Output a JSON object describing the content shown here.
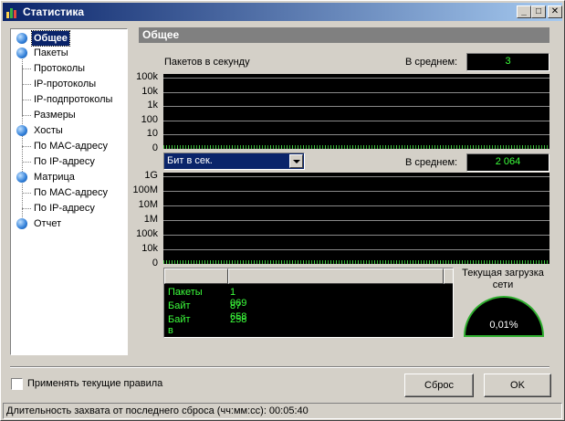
{
  "window": {
    "title": "Статистика",
    "minimize": "_",
    "maximize": "□",
    "close": "✕"
  },
  "tree": {
    "general": "Общее",
    "packets": "Пакеты",
    "protocols": "Протоколы",
    "ip_protocols": "IP-протоколы",
    "ip_subprotocols": "IP-подпротоколы",
    "sizes": "Размеры",
    "hosts": "Хосты",
    "hosts_mac": "По MAC-адресу",
    "hosts_ip": "По IP-адресу",
    "matrix": "Матрица",
    "matrix_mac": "По MAC-адресу",
    "matrix_ip": "По IP-адресу",
    "report": "Отчет"
  },
  "panel": {
    "header": "Общее",
    "pps_label": "Пакетов в секунду",
    "avg_label": "В среднем:",
    "pps_avg": "3",
    "pps_ticks": [
      "100k",
      "10k",
      "1k",
      "100",
      "10",
      "0"
    ],
    "bps_combo": "Бит в сек.",
    "bps_avg": "2 064",
    "bps_ticks": [
      "1G",
      "100M",
      "10M",
      "1M",
      "100k",
      "10k",
      "0"
    ],
    "stats": [
      {
        "k": "Пакеты",
        "v": "1 069"
      },
      {
        "k": "Байт",
        "v": "87 658"
      },
      {
        "k": "Байт в сек.",
        "v": "258"
      }
    ],
    "load_label_1": "Текущая загрузка",
    "load_label_2": "сети",
    "load_value": "0,01%"
  },
  "footer": {
    "apply_rules": "Применять текущие правила",
    "reset": "Сброс",
    "ok": "OK"
  },
  "status": {
    "text": "Длительность захвата от последнего сброса (чч:мм:сс): 00:05:40"
  },
  "colors": {
    "accent": "#0a246a",
    "graph_text": "#3cff3c"
  }
}
